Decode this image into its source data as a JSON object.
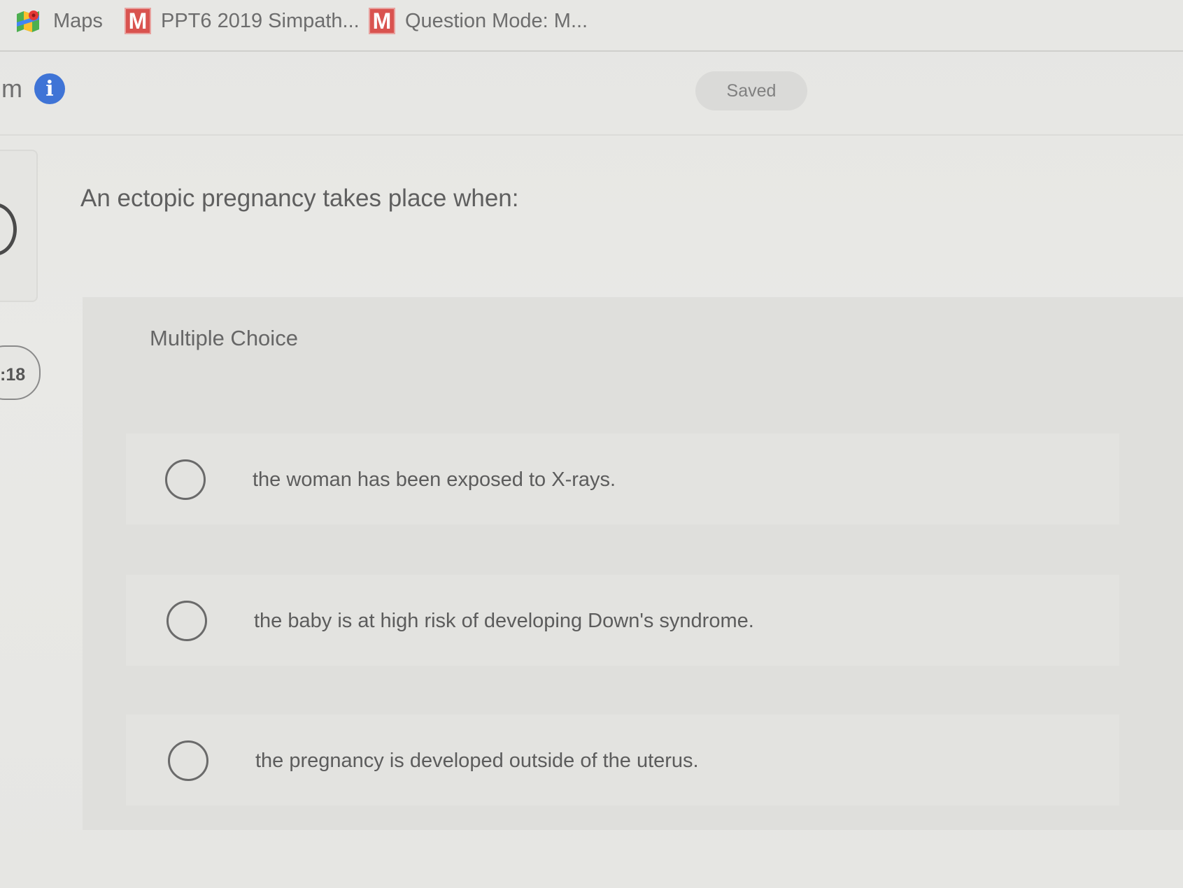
{
  "bookmarks": [
    {
      "label": "Maps",
      "icon": "maps-icon"
    },
    {
      "label": "PPT6 2019 Simpath...",
      "icon": "m-icon"
    },
    {
      "label": "Question Mode: M...",
      "icon": "m-icon"
    }
  ],
  "bookmark_icon_letter": "M",
  "header": {
    "title_fragment": "m",
    "info_icon_glyph": "i",
    "saved_label": "Saved"
  },
  "timer": {
    "text": ":18"
  },
  "question": {
    "text": "An ectopic pregnancy takes place when:",
    "type_label": "Multiple Choice",
    "options": [
      {
        "text": "the woman has been exposed to X-rays.",
        "selected": false
      },
      {
        "text": "the baby is at high risk of developing Down's syndrome.",
        "selected": false
      },
      {
        "text": "the pregnancy is developed outside of the uterus.",
        "selected": false
      }
    ]
  },
  "colors": {
    "info_blue": "#3f74d6",
    "m_icon_red": "#d9534f"
  }
}
